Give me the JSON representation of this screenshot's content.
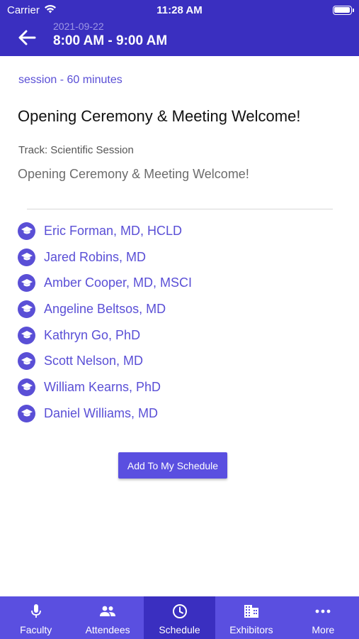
{
  "status_bar": {
    "carrier": "Carrier",
    "time": "11:28 AM"
  },
  "header": {
    "date": "2021-09-22",
    "time_range": "8:00 AM - 9:00 AM"
  },
  "session": {
    "type_label": "session - 60 minutes",
    "title": "Opening Ceremony & Meeting Welcome!",
    "track_label": "Track:",
    "track_value": "Scientific Session",
    "description": "Opening Ceremony & Meeting Welcome!"
  },
  "speakers": [
    {
      "name": "Eric Forman, MD, HCLD",
      "icon": "graduation-cap-icon"
    },
    {
      "name": "Jared Robins, MD",
      "icon": "graduation-cap-icon"
    },
    {
      "name": "Amber Cooper, MD, MSCI",
      "icon": "graduation-cap-icon"
    },
    {
      "name": "Angeline Beltsos, MD",
      "icon": "graduation-cap-icon"
    },
    {
      "name": "Kathryn Go, PhD",
      "icon": "graduation-cap-icon"
    },
    {
      "name": "Scott Nelson, MD",
      "icon": "graduation-cap-icon"
    },
    {
      "name": "William Kearns, PhD",
      "icon": "graduation-cap-icon"
    },
    {
      "name": "Daniel Williams, MD",
      "icon": "graduation-cap-icon"
    }
  ],
  "actions": {
    "add_to_schedule": "Add To My Schedule"
  },
  "tabs": [
    {
      "label": "Faculty",
      "icon": "microphone-icon",
      "active": false
    },
    {
      "label": "Attendees",
      "icon": "people-icon",
      "active": false
    },
    {
      "label": "Schedule",
      "icon": "clock-icon",
      "active": true
    },
    {
      "label": "Exhibitors",
      "icon": "building-icon",
      "active": false
    },
    {
      "label": "More",
      "icon": "more-dots-icon",
      "active": false
    }
  ],
  "colors": {
    "header_bg": "#3a2fc0",
    "accent": "#5a4fd6",
    "tabbar_bg": "#5a4fe0"
  }
}
